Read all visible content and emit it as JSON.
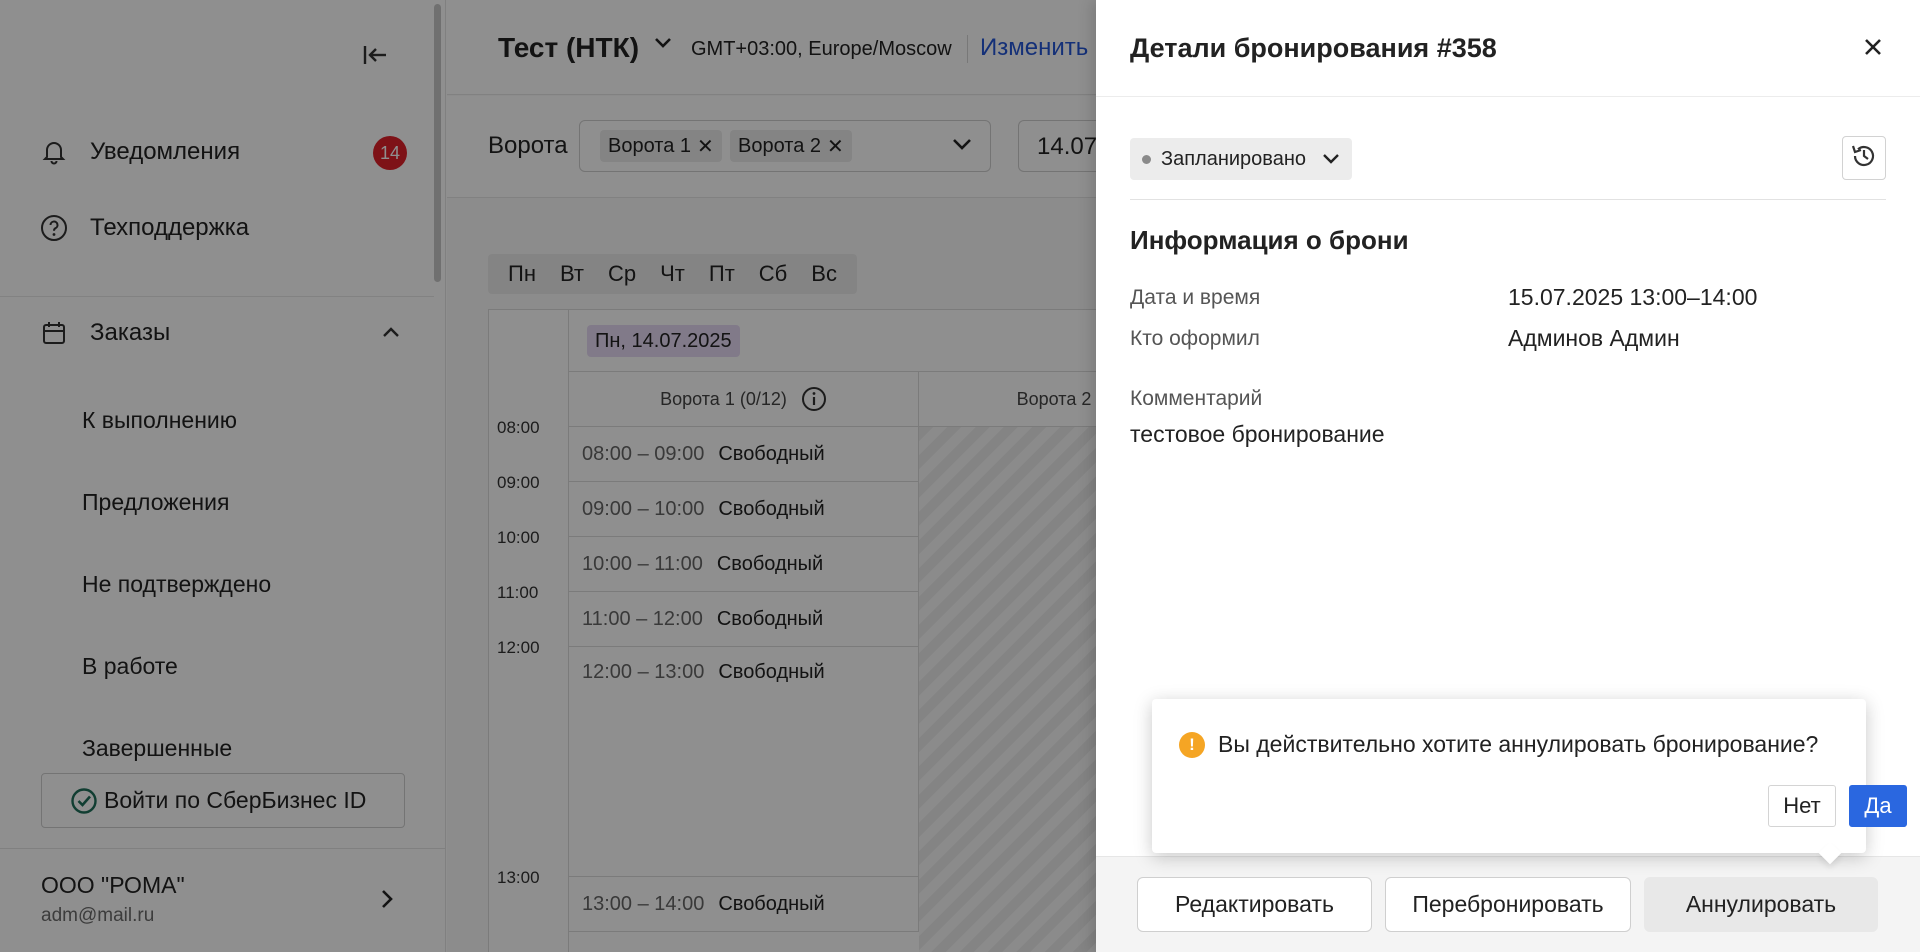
{
  "sidebar": {
    "notifications_label": "Уведомления",
    "notifications_count": "14",
    "support_label": "Техподдержка",
    "orders_label": "Заказы",
    "order_items": [
      {
        "label": "К выполнению"
      },
      {
        "label": "Предложения"
      },
      {
        "label": "Не подтверждено"
      },
      {
        "label": "В работе"
      },
      {
        "label": "Завершенные"
      }
    ],
    "sber_login_label": "Войти по СберБизнес ID",
    "company_name": "ООО \"РОМА\"",
    "company_email": "adm@mail.ru"
  },
  "header": {
    "warehouse": "Тест (НТК)",
    "timezone": "GMT+03:00, Europe/Moscow",
    "change_link": "Изменить"
  },
  "filters": {
    "gates_label": "Ворота",
    "gate_chips": [
      "Ворота 1",
      "Ворота 2"
    ],
    "date_value": "14.07"
  },
  "weekdays": [
    "Пн",
    "Вт",
    "Ср",
    "Чт",
    "Пт",
    "Сб",
    "Вс"
  ],
  "schedule": {
    "date_chip": "Пн, 14.07.2025",
    "columns": [
      "Ворота 1 (0/12)",
      "Ворота 2"
    ],
    "hours": [
      "08:00",
      "09:00",
      "10:00",
      "11:00",
      "12:00",
      "13:00"
    ],
    "slots": [
      {
        "time": "08:00 – 09:00",
        "status": "Свободный"
      },
      {
        "time": "09:00 – 10:00",
        "status": "Свободный"
      },
      {
        "time": "10:00 – 11:00",
        "status": "Свободный"
      },
      {
        "time": "11:00 – 12:00",
        "status": "Свободный"
      },
      {
        "time": "12:00 – 13:00",
        "status": "Свободный"
      },
      {
        "time": "13:00 – 14:00",
        "status": "Свободный"
      }
    ]
  },
  "drawer": {
    "title": "Детали бронирования #358",
    "status": "Запланировано",
    "section_title": "Информация о брони",
    "datetime_label": "Дата и время",
    "datetime_value": "15.07.2025 13:00–14:00",
    "author_label": "Кто оформил",
    "author_value": "Админов Админ",
    "comment_label": "Комментарий",
    "comment_value": "тестовое бронирование",
    "confirm": {
      "text": "Вы действительно хотите аннулировать бронирование?",
      "no_label": "Нет",
      "yes_label": "Да"
    },
    "footer": {
      "edit_label": "Редактировать",
      "rebook_label": "Перебронировать",
      "cancel_label": "Аннулировать"
    }
  },
  "colors": {
    "accent": "#2a67e0",
    "link": "#2557d6",
    "badge": "#e0202a",
    "warning": "#f5a524",
    "date_chip": "#e6d9f4"
  }
}
